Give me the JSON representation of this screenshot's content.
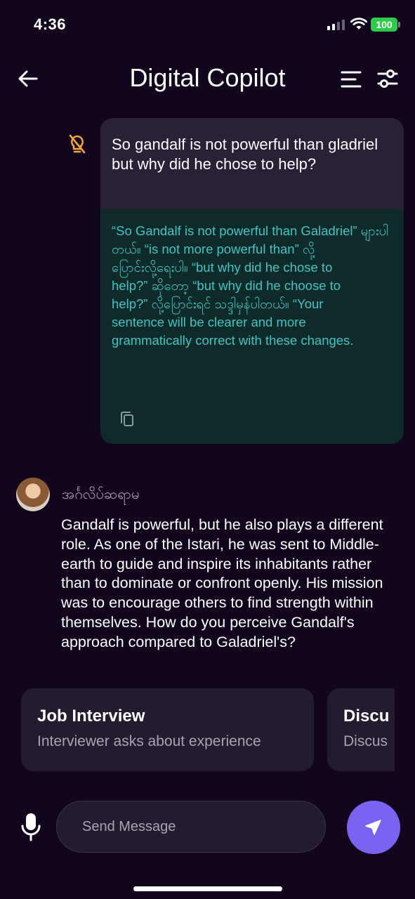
{
  "status_bar": {
    "time": "4:36",
    "battery": "100",
    "battery_color": "#30c94c"
  },
  "header": {
    "title": "Digital Copilot",
    "back_icon": "arrow-left-icon",
    "menu_icon": "menu-lines-icon",
    "settings_icon": "tune-sliders-icon"
  },
  "user_message": {
    "text": "So gandalf is not powerful than gladriel but why did he chose to help?",
    "hint_icon": "lightbulb-off-icon"
  },
  "correction": {
    "text": "“So Gandalf is not powerful than Galadriel” များပါတယ်။ “is not more powerful than” လို့\nပြောင်းလို့ရေးပါ။ “but why did he chose to\nhelp?” ဆိုတော့ “but why did he choose to\nhelp?” လို့ပြောင်းရင် သဒ္ဒါမှန်ပါတယ်။ “Your\nsentence will be clearer and more\ngrammatically correct with these changes.",
    "copy_icon": "copy-icon",
    "text_color": "#43c3c4"
  },
  "assistant": {
    "name": "အင်္ဂလိပ်ဆရာမ",
    "message": "Gandalf is powerful, but he also plays a different role. As one of the Istari, he was sent to Middle-earth to guide and inspire its inhabitants rather than to dominate or confront openly. His mission was to encourage others to find strength within themselves. How do you perceive Gandalf's approach compared to Galadriel's?"
  },
  "suggestions": [
    {
      "title": "Job Interview",
      "subtitle": "Interviewer asks about experience"
    },
    {
      "title": "Discu",
      "subtitle": "Discus"
    }
  ],
  "composer": {
    "placeholder": "Send Message",
    "mic_icon": "microphone-icon",
    "send_icon": "send-icon",
    "send_color": "#7a63f0"
  }
}
